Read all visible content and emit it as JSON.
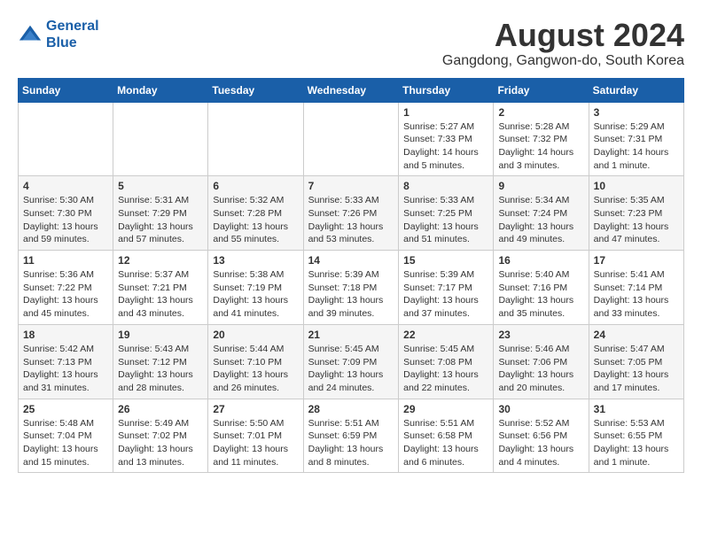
{
  "header": {
    "logo_line1": "General",
    "logo_line2": "Blue",
    "month_year": "August 2024",
    "location": "Gangdong, Gangwon-do, South Korea"
  },
  "days_of_week": [
    "Sunday",
    "Monday",
    "Tuesday",
    "Wednesday",
    "Thursday",
    "Friday",
    "Saturday"
  ],
  "weeks": [
    [
      {
        "day": "",
        "info": ""
      },
      {
        "day": "",
        "info": ""
      },
      {
        "day": "",
        "info": ""
      },
      {
        "day": "",
        "info": ""
      },
      {
        "day": "1",
        "info": "Sunrise: 5:27 AM\nSunset: 7:33 PM\nDaylight: 14 hours\nand 5 minutes."
      },
      {
        "day": "2",
        "info": "Sunrise: 5:28 AM\nSunset: 7:32 PM\nDaylight: 14 hours\nand 3 minutes."
      },
      {
        "day": "3",
        "info": "Sunrise: 5:29 AM\nSunset: 7:31 PM\nDaylight: 14 hours\nand 1 minute."
      }
    ],
    [
      {
        "day": "4",
        "info": "Sunrise: 5:30 AM\nSunset: 7:30 PM\nDaylight: 13 hours\nand 59 minutes."
      },
      {
        "day": "5",
        "info": "Sunrise: 5:31 AM\nSunset: 7:29 PM\nDaylight: 13 hours\nand 57 minutes."
      },
      {
        "day": "6",
        "info": "Sunrise: 5:32 AM\nSunset: 7:28 PM\nDaylight: 13 hours\nand 55 minutes."
      },
      {
        "day": "7",
        "info": "Sunrise: 5:33 AM\nSunset: 7:26 PM\nDaylight: 13 hours\nand 53 minutes."
      },
      {
        "day": "8",
        "info": "Sunrise: 5:33 AM\nSunset: 7:25 PM\nDaylight: 13 hours\nand 51 minutes."
      },
      {
        "day": "9",
        "info": "Sunrise: 5:34 AM\nSunset: 7:24 PM\nDaylight: 13 hours\nand 49 minutes."
      },
      {
        "day": "10",
        "info": "Sunrise: 5:35 AM\nSunset: 7:23 PM\nDaylight: 13 hours\nand 47 minutes."
      }
    ],
    [
      {
        "day": "11",
        "info": "Sunrise: 5:36 AM\nSunset: 7:22 PM\nDaylight: 13 hours\nand 45 minutes."
      },
      {
        "day": "12",
        "info": "Sunrise: 5:37 AM\nSunset: 7:21 PM\nDaylight: 13 hours\nand 43 minutes."
      },
      {
        "day": "13",
        "info": "Sunrise: 5:38 AM\nSunset: 7:19 PM\nDaylight: 13 hours\nand 41 minutes."
      },
      {
        "day": "14",
        "info": "Sunrise: 5:39 AM\nSunset: 7:18 PM\nDaylight: 13 hours\nand 39 minutes."
      },
      {
        "day": "15",
        "info": "Sunrise: 5:39 AM\nSunset: 7:17 PM\nDaylight: 13 hours\nand 37 minutes."
      },
      {
        "day": "16",
        "info": "Sunrise: 5:40 AM\nSunset: 7:16 PM\nDaylight: 13 hours\nand 35 minutes."
      },
      {
        "day": "17",
        "info": "Sunrise: 5:41 AM\nSunset: 7:14 PM\nDaylight: 13 hours\nand 33 minutes."
      }
    ],
    [
      {
        "day": "18",
        "info": "Sunrise: 5:42 AM\nSunset: 7:13 PM\nDaylight: 13 hours\nand 31 minutes."
      },
      {
        "day": "19",
        "info": "Sunrise: 5:43 AM\nSunset: 7:12 PM\nDaylight: 13 hours\nand 28 minutes."
      },
      {
        "day": "20",
        "info": "Sunrise: 5:44 AM\nSunset: 7:10 PM\nDaylight: 13 hours\nand 26 minutes."
      },
      {
        "day": "21",
        "info": "Sunrise: 5:45 AM\nSunset: 7:09 PM\nDaylight: 13 hours\nand 24 minutes."
      },
      {
        "day": "22",
        "info": "Sunrise: 5:45 AM\nSunset: 7:08 PM\nDaylight: 13 hours\nand 22 minutes."
      },
      {
        "day": "23",
        "info": "Sunrise: 5:46 AM\nSunset: 7:06 PM\nDaylight: 13 hours\nand 20 minutes."
      },
      {
        "day": "24",
        "info": "Sunrise: 5:47 AM\nSunset: 7:05 PM\nDaylight: 13 hours\nand 17 minutes."
      }
    ],
    [
      {
        "day": "25",
        "info": "Sunrise: 5:48 AM\nSunset: 7:04 PM\nDaylight: 13 hours\nand 15 minutes."
      },
      {
        "day": "26",
        "info": "Sunrise: 5:49 AM\nSunset: 7:02 PM\nDaylight: 13 hours\nand 13 minutes."
      },
      {
        "day": "27",
        "info": "Sunrise: 5:50 AM\nSunset: 7:01 PM\nDaylight: 13 hours\nand 11 minutes."
      },
      {
        "day": "28",
        "info": "Sunrise: 5:51 AM\nSunset: 6:59 PM\nDaylight: 13 hours\nand 8 minutes."
      },
      {
        "day": "29",
        "info": "Sunrise: 5:51 AM\nSunset: 6:58 PM\nDaylight: 13 hours\nand 6 minutes."
      },
      {
        "day": "30",
        "info": "Sunrise: 5:52 AM\nSunset: 6:56 PM\nDaylight: 13 hours\nand 4 minutes."
      },
      {
        "day": "31",
        "info": "Sunrise: 5:53 AM\nSunset: 6:55 PM\nDaylight: 13 hours\nand 1 minute."
      }
    ]
  ]
}
